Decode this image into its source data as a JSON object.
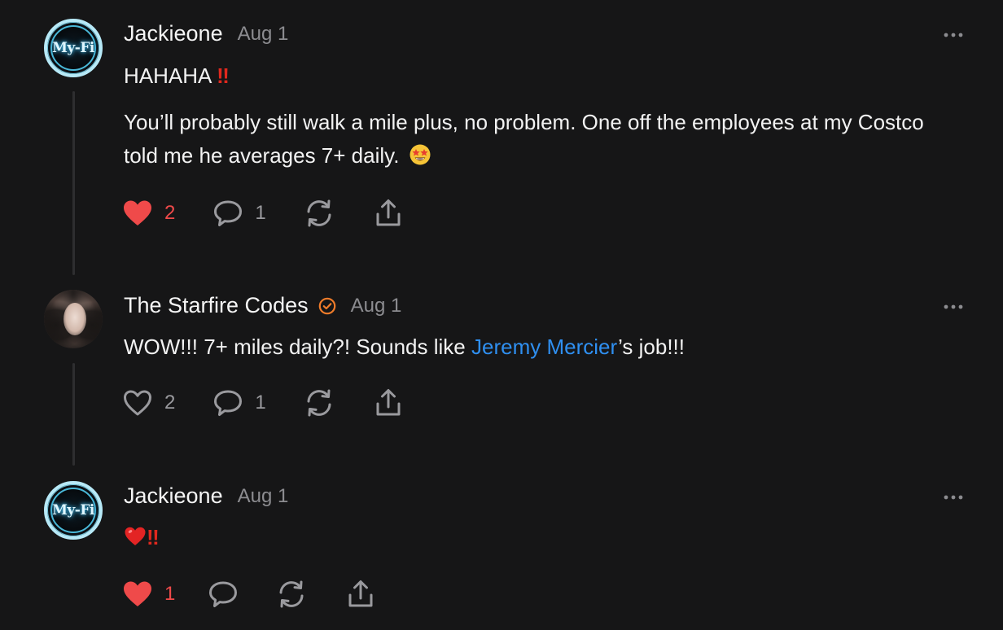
{
  "comments": [
    {
      "author": "Jackieone",
      "date": "Aug 1",
      "avatar": "myfi-logo-avatar",
      "avatar_text": "My-Fi",
      "paragraphs": [
        "HAHAHA",
        "You’ll probably still walk a mile plus, no problem. One off the employees at my Costco told me he averages 7+ daily."
      ],
      "inline_emoji": [
        "double-exclamation",
        "star-struck-face"
      ],
      "likes": "2",
      "liked": true,
      "replies": "1"
    },
    {
      "author": "The Starfire Codes",
      "date": "Aug 1",
      "avatar": "profile-photo-avatar",
      "verified": true,
      "text_before": "WOW!!! 7+ miles daily?! Sounds like ",
      "mention": "Jeremy Mercier",
      "text_after": "’s job!!!",
      "likes": "2",
      "liked": false,
      "replies": "1"
    },
    {
      "author": "Jackieone",
      "date": "Aug 1",
      "avatar": "myfi-logo-avatar",
      "avatar_text": "My-Fi",
      "inline_emoji": [
        "red-heart",
        "double-exclamation"
      ],
      "likes": "1",
      "liked": true,
      "replies": ""
    }
  ],
  "colors": {
    "background": "#161617",
    "liked_heart": "#ef4a4a",
    "mention": "#2f8ff0",
    "verified_badge": "#f07c2a",
    "icon_gray": "#9a9a9e"
  }
}
